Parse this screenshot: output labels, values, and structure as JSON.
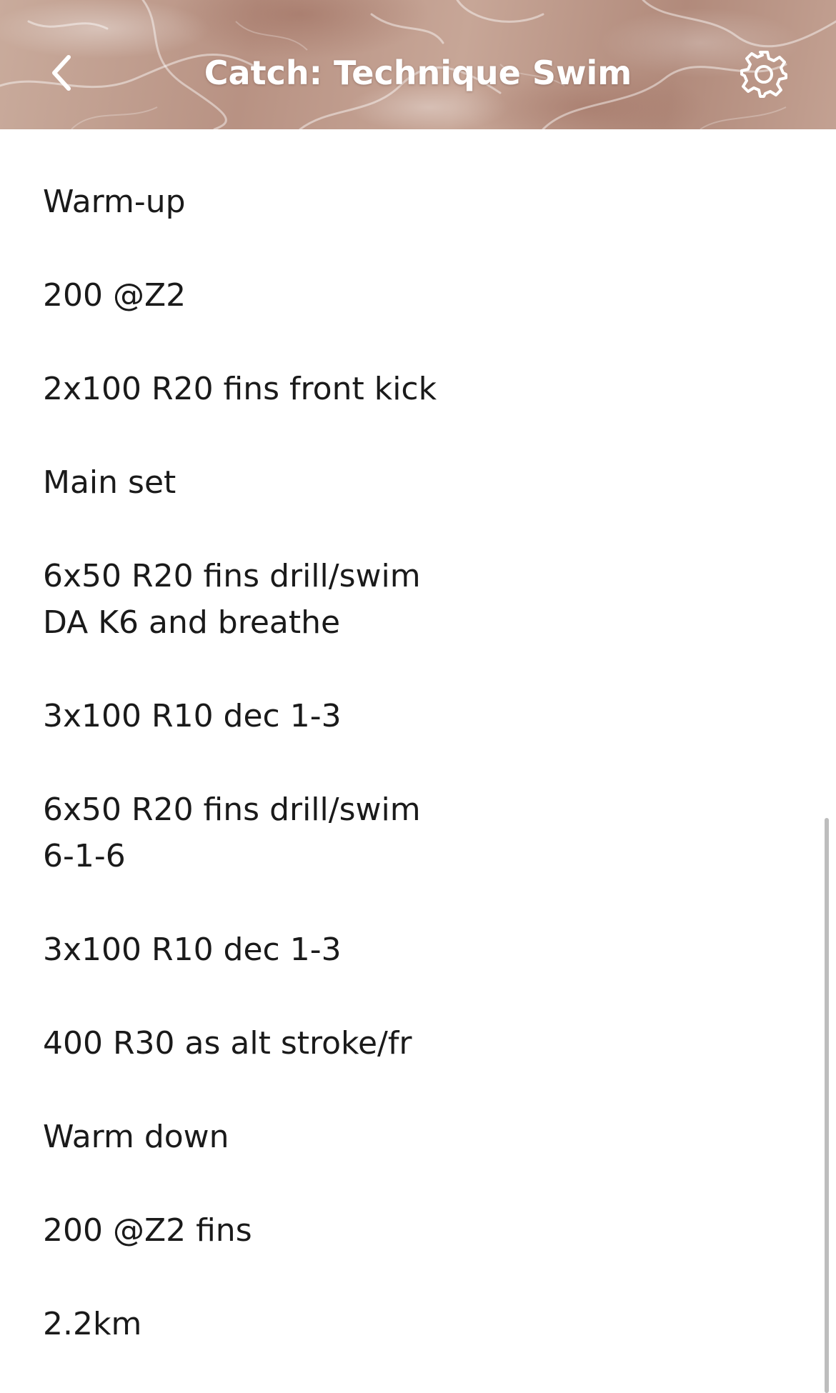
{
  "header": {
    "title": "Catch: Technique Swim",
    "back_icon": "chevron-left-icon",
    "settings_icon": "gear-icon"
  },
  "workout": {
    "lines": [
      "Warm-up",
      "200 @Z2",
      "2x100 R20 fins front kick",
      "Main set",
      "6x50 R20 fins drill/swim\nDA K6 and breathe",
      "3x100 R10 dec 1-3",
      "6x50 R20 fins drill/swim\n6-1-6",
      "3x100 R10 dec 1-3",
      "400 R30 as alt stroke/fr",
      "Warm down",
      "200 @Z2 fins",
      "2.2km"
    ]
  },
  "colors": {
    "header_tint": "#c4a394",
    "text": "#1a1a1a",
    "scrollbar": "#bdbdbd"
  }
}
